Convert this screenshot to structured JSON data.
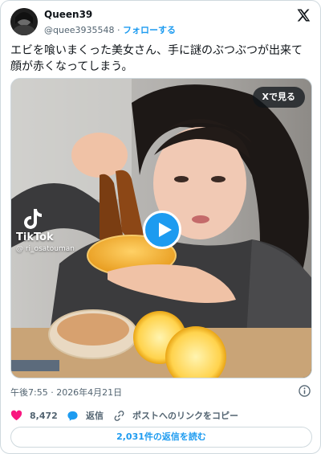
{
  "author": {
    "name": "Queen39",
    "handle": "@quee3935548",
    "separator": "·",
    "follow_label": "フォローする"
  },
  "tweet": {
    "text": "エビを喰いまくった美女さん、手に謎のぶつぶつが出来て顔が赤くなってしまう。"
  },
  "media": {
    "view_on_x_label": "Xで見る",
    "watermark_brand": "TikTok",
    "watermark_user": "@ ri_osatouman"
  },
  "meta": {
    "timestamp": "午後7:55 · 2026年4月21日"
  },
  "actions": {
    "like_count": "8,472",
    "reply_label": "返信",
    "copy_link_label": "ポストへのリンクをコピー"
  },
  "footer": {
    "read_replies_label": "2,031件の返信を読む"
  },
  "colors": {
    "accent": "#1d9bf0",
    "like": "#f91880",
    "text": "#0f1419",
    "secondary": "#536471",
    "border": "#cfd9de"
  },
  "icons": [
    "avatar",
    "x-logo-icon",
    "play-icon",
    "tiktok-icon",
    "info-icon",
    "heart-icon",
    "reply-bubble-icon",
    "link-icon"
  ]
}
